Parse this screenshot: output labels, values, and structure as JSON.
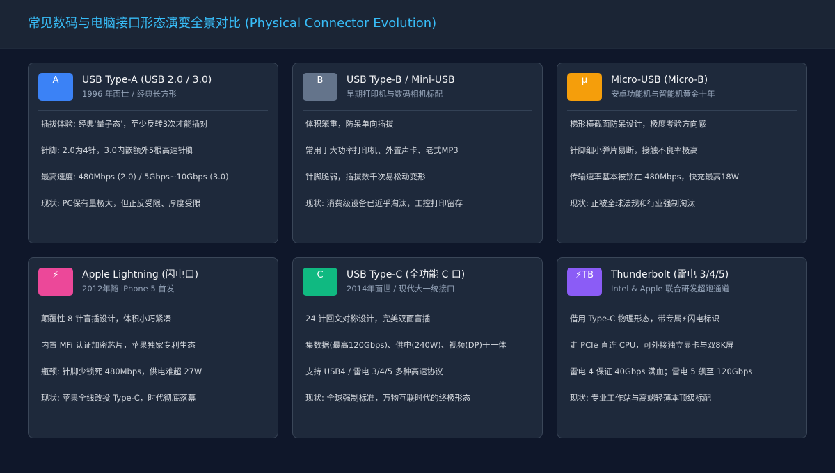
{
  "page": {
    "title": "常见数码与电脑接口形态演变全景对比 (Physical Connector Evolution)"
  },
  "cards": [
    {
      "badge": "A",
      "color": "#3b82f6",
      "title": "USB Type-A (USB 2.0 / 3.0)",
      "subtitle": "1996 年面世 / 经典长方形",
      "lines": [
        "插拔体验: 经典'量子态'，至少反转3次才能插对",
        "针脚: 2.0为4针，3.0内嵌额外5根高速针脚",
        "最高速度: 480Mbps (2.0) / 5Gbps~10Gbps (3.0)",
        "现状: PC保有量极大，但正反受限、厚度受限"
      ]
    },
    {
      "badge": "B",
      "color": "#64748b",
      "title": "USB Type-B / Mini-USB",
      "subtitle": "早期打印机与数码相机标配",
      "lines": [
        "体积笨重，防呆单向插拔",
        "常用于大功率打印机、外置声卡、老式MP3",
        "针脚脆弱，插拔数千次易松动变形",
        "现状: 消费级设备已近乎淘汰，工控打印留存"
      ]
    },
    {
      "badge": "μ",
      "color": "#f59e0b",
      "title": "Micro-USB (Micro-B)",
      "subtitle": "安卓功能机与智能机黄金十年",
      "lines": [
        "梯形横截面防呆设计，极度考验方向感",
        "针脚细小弹片易断，接触不良率极高",
        "传输速率基本被锁在 480Mbps，快充最高18W",
        "现状: 正被全球法规和行业强制淘汰"
      ]
    },
    {
      "badge": "⚡",
      "color": "#ec4899",
      "title": "Apple Lightning (闪电口)",
      "subtitle": "2012年随 iPhone 5 首发",
      "lines": [
        "颠覆性 8 针盲插设计，体积小巧紧凑",
        "内置 MFi 认证加密芯片，苹果独家专利生态",
        "瓶颈: 针脚少锁死 480Mbps，供电难超 27W",
        "现状: 苹果全线改投 Type-C，时代彻底落幕"
      ]
    },
    {
      "badge": "C",
      "color": "#10b981",
      "title": "USB Type-C (全功能 C 口)",
      "subtitle": "2014年面世 / 现代大一统接口",
      "lines": [
        "24 针回文对称设计，完美双面盲插",
        "集数据(最高120Gbps)、供电(240W)、视频(DP)于一体",
        "支持 USB4 / 雷电 3/4/5 多种高速协议",
        "现状: 全球强制标准，万物互联时代的终极形态"
      ]
    },
    {
      "badge": "⚡TB",
      "color": "#8b5cf6",
      "title": "Thunderbolt (雷电 3/4/5)",
      "subtitle": "Intel & Apple 联合研发超跑通道",
      "lines": [
        "借用 Type-C 物理形态，带专属⚡闪电标识",
        "走 PCIe 直连 CPU，可外接独立显卡与双8K屏",
        "雷电 4 保证 40Gbps 满血；雷电 5 飙至 120Gbps",
        "现状: 专业工作站与高端轻薄本顶级标配"
      ]
    }
  ]
}
